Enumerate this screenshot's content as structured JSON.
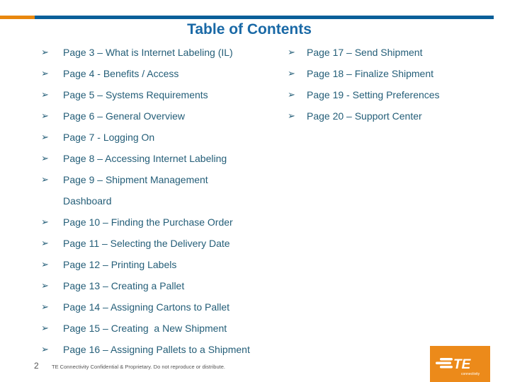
{
  "colors": {
    "accent_orange": "#e8870e",
    "accent_blue": "#0a5f99",
    "title": "#1a69a6",
    "text": "#245e78"
  },
  "title": "Table of Contents",
  "bullet_icon": "arrowhead-bullet",
  "bullet_glyph": "➢",
  "left_items": [
    {
      "label": "Page 3 – What is Internet Labeling (IL)"
    },
    {
      "label": "Page 4 - Benefits / Access"
    },
    {
      "label": "Page 5 – Systems Requirements"
    },
    {
      "label": "Page 6 – General Overview"
    },
    {
      "label": "Page 7 - Logging On"
    },
    {
      "label": "Page 8 – Accessing Internet Labeling"
    },
    {
      "label": "Page 9 – Shipment Management"
    },
    {
      "label": "Dashboard"
    },
    {
      "label": "Page 10 – Finding the Purchase Order"
    },
    {
      "label": "Page 11 – Selecting the Delivery Date"
    },
    {
      "label": "Page 12 – Printing Labels"
    },
    {
      "label": "Page 13 – Creating a Pallet"
    },
    {
      "label": "Page 14 – Assigning Cartons to Pallet"
    },
    {
      "label": "Page 15 – Creating  a New Shipment"
    },
    {
      "label": "Page 16 – Assigning Pallets to a Shipment"
    }
  ],
  "right_items": [
    {
      "label": "Page 17 – Send Shipment"
    },
    {
      "label": "Page 18 – Finalize Shipment"
    },
    {
      "label": "Page 19 - Setting Preferences"
    },
    {
      "label": "Page 20 – Support Center"
    }
  ],
  "footer": {
    "page_number": "2",
    "text": "TE Connectivity Confidential & Proprietary. Do not reproduce or distribute."
  },
  "logo": {
    "mark": "TE",
    "tagline": "connectivity"
  }
}
